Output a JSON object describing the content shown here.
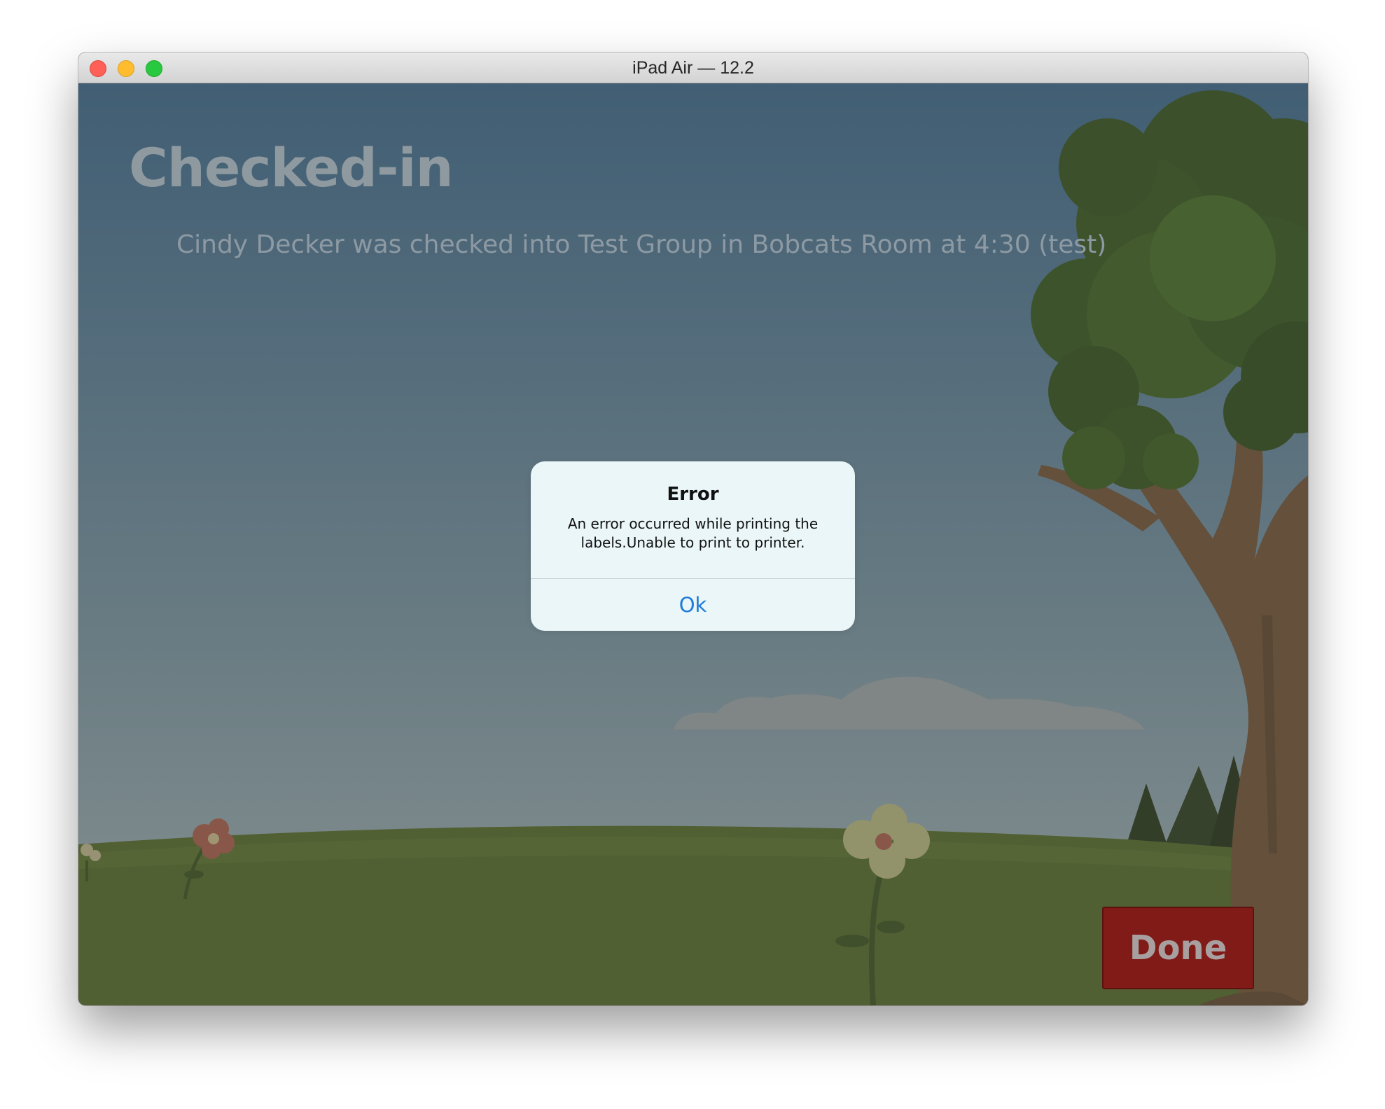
{
  "window": {
    "title": "iPad Air — 12.2"
  },
  "screen": {
    "title": "Checked-in",
    "message": "Cindy Decker was checked into Test Group in Bobcats Room at 4:30 (test)",
    "done_label": "Done"
  },
  "alert": {
    "title": "Error",
    "message": "An error occurred while printing the labels.Unable to print to printer.",
    "ok_label": "Ok"
  },
  "colors": {
    "sky_top": "#3f6680",
    "sky_bottom": "#9fb1b1",
    "grass": "#5a6d28",
    "done_button": "#811b17",
    "alert_link": "#1e7bd8"
  }
}
